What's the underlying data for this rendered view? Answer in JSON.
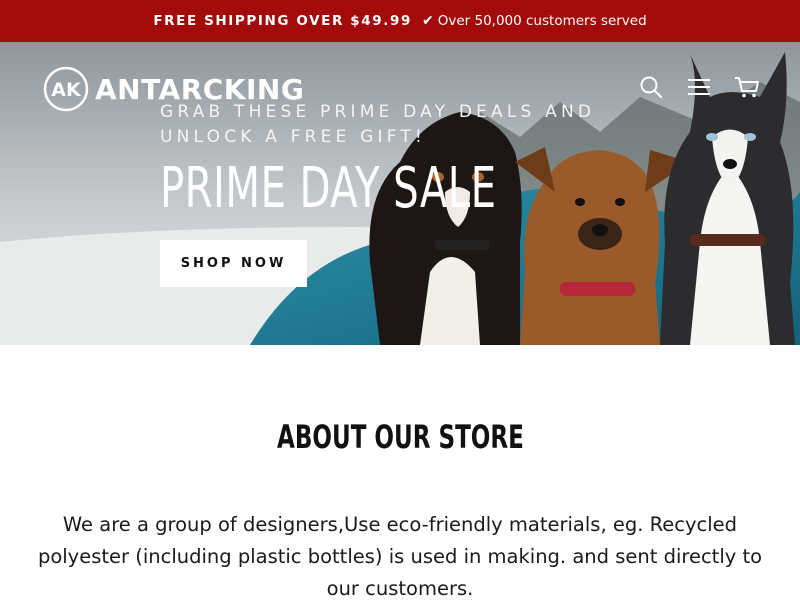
{
  "announcement": {
    "shipping": "FREE SHIPPING OVER $49.99",
    "check_icon": "✔",
    "customers": "Over 50,000 customers served",
    "background": "#a30a0a"
  },
  "header": {
    "logo_mark": "AK",
    "logo_text": "ANTARCKING",
    "icons": [
      "search-icon",
      "menu-icon",
      "cart-icon"
    ]
  },
  "hero": {
    "tagline": "GRAB THESE PRIME DAY DEALS AND UNLOCK A FREE GIFT!",
    "headline": "PRIME DAY SALE",
    "cta_label": "SHOP NOW"
  },
  "about": {
    "title": "ABOUT OUR STORE",
    "body": "We are a group of designers,Use eco-friendly materials, eg. Recycled polyester (including plastic bottles) is used in making. and sent directly to our customers."
  }
}
